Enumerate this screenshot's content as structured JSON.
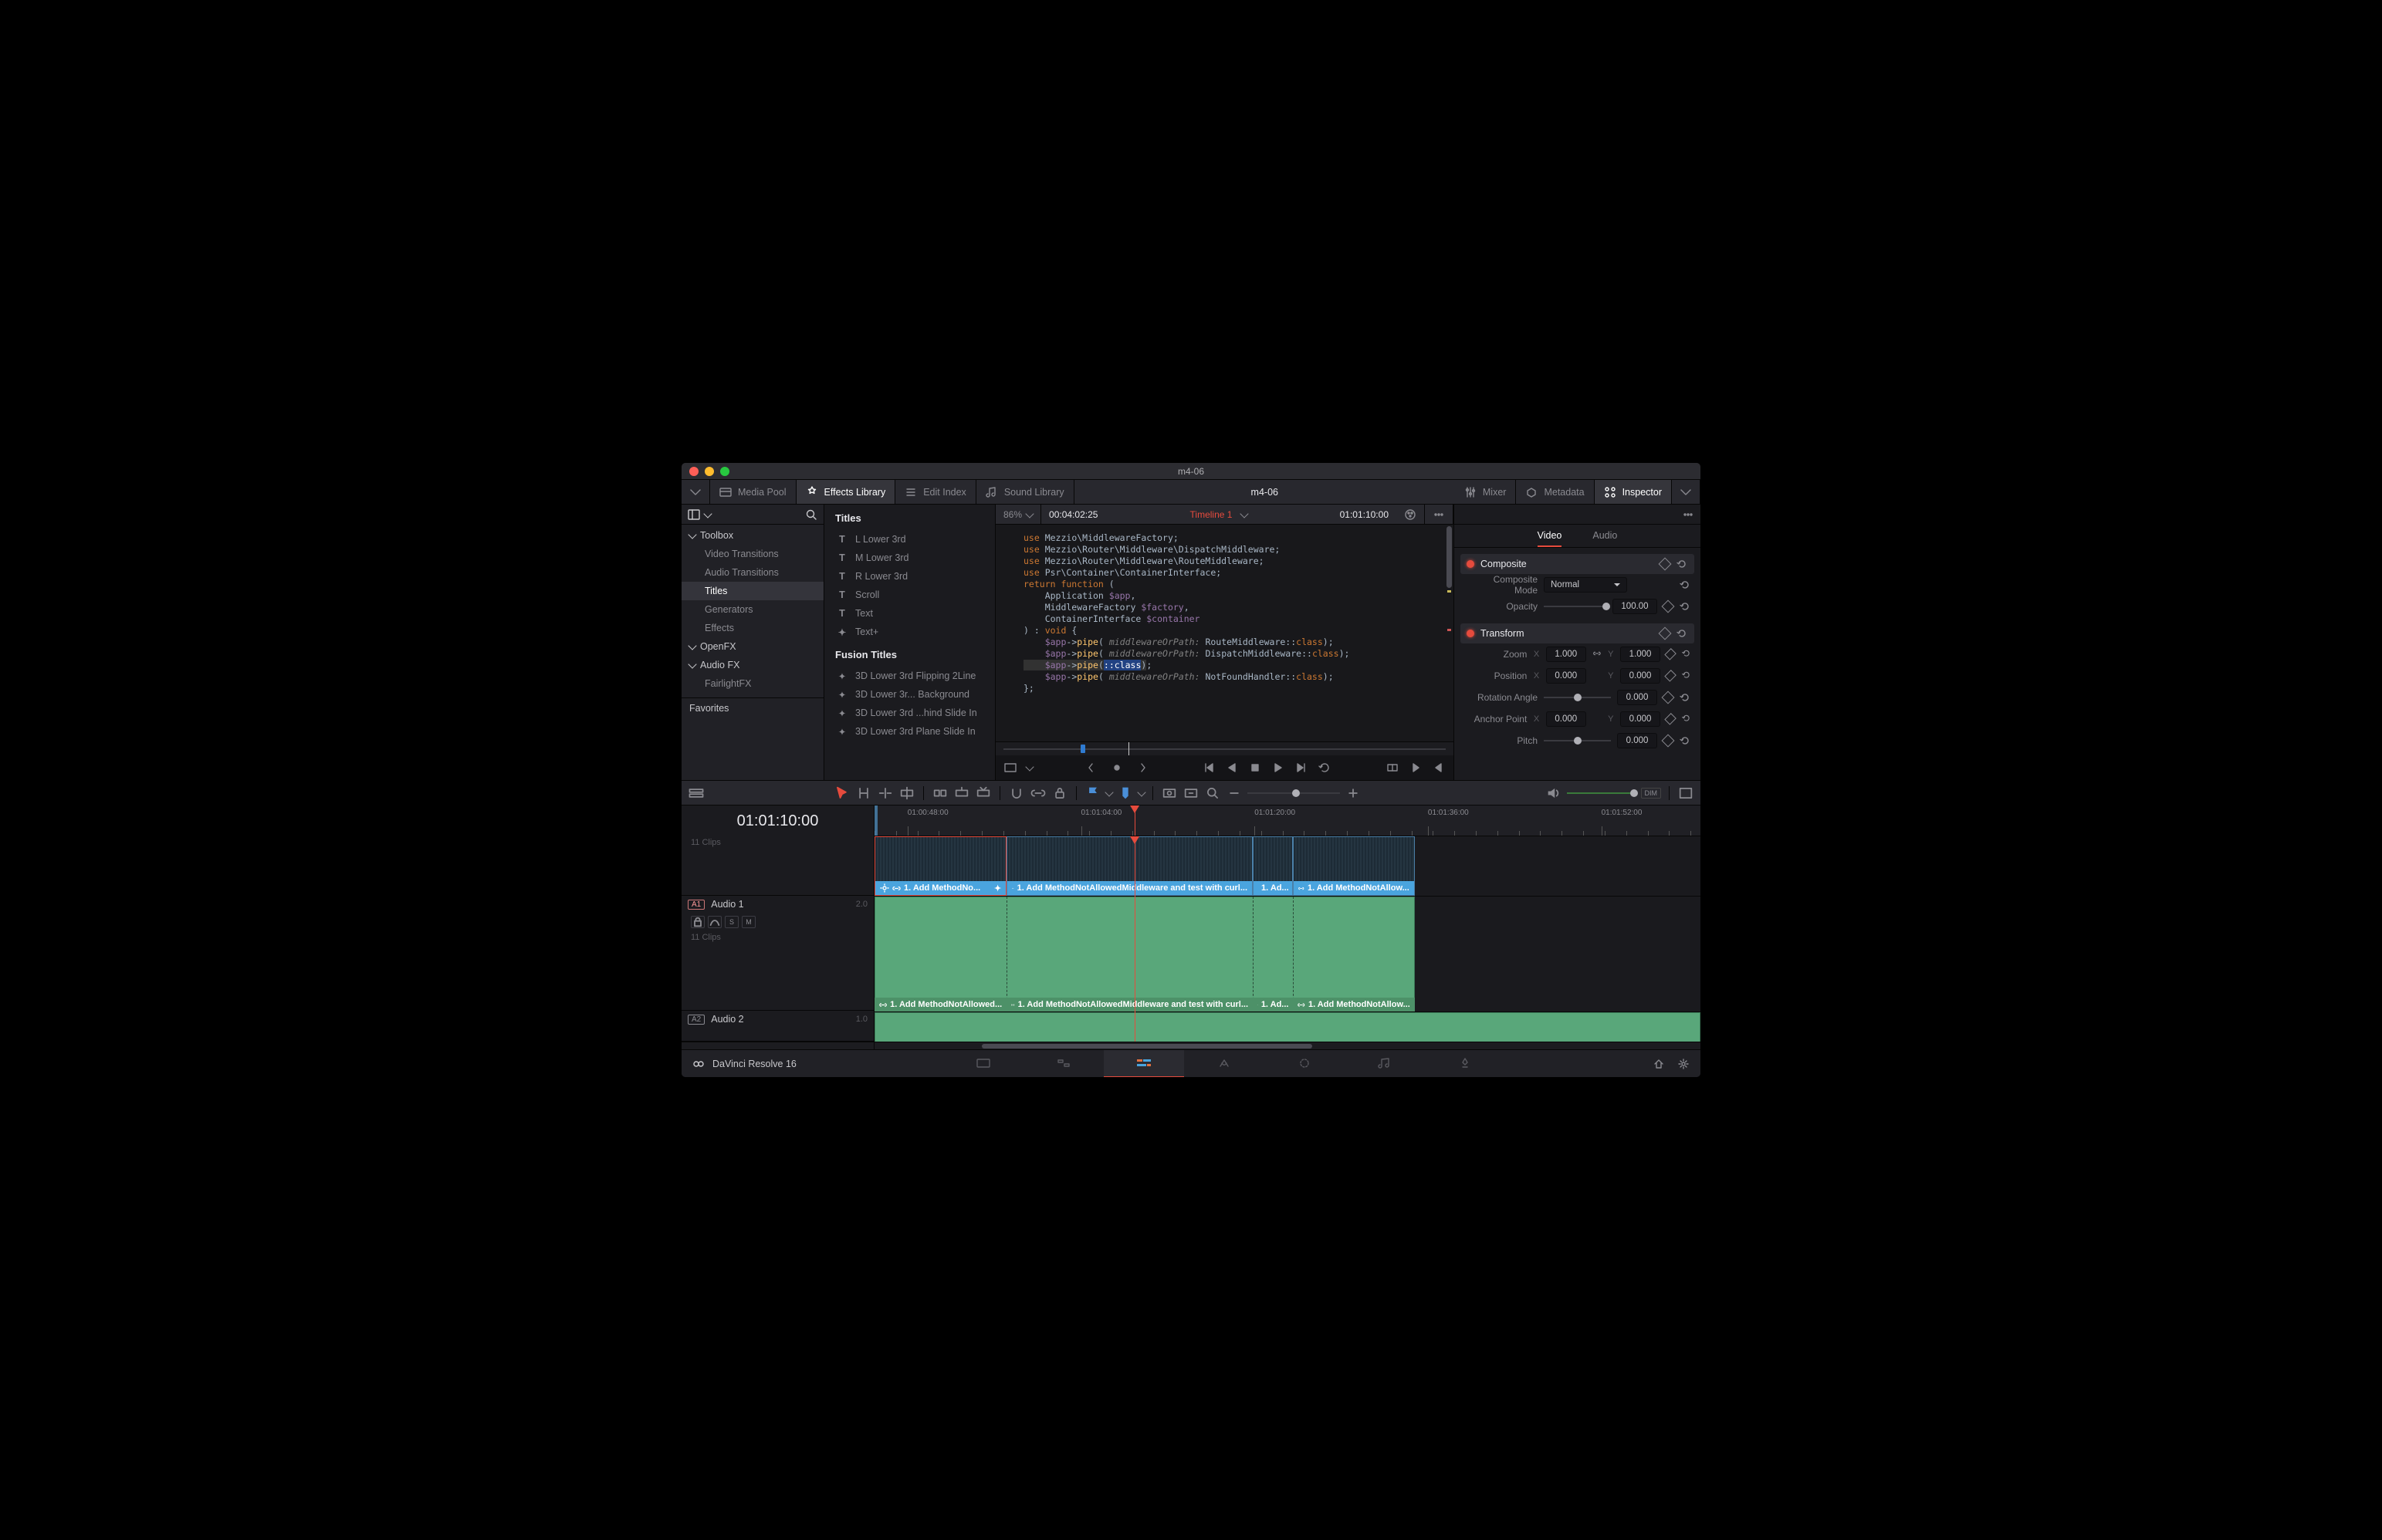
{
  "window": {
    "title": "m4-06"
  },
  "toolbar": {
    "media_pool": "Media Pool",
    "effects_library": "Effects Library",
    "edit_index": "Edit Index",
    "sound_library": "Sound Library",
    "doc_title": "m4-06",
    "mixer": "Mixer",
    "metadata": "Metadata",
    "inspector": "Inspector"
  },
  "sidebar": {
    "tree": [
      {
        "label": "Toolbox",
        "group": true
      },
      {
        "label": "Video Transitions"
      },
      {
        "label": "Audio Transitions"
      },
      {
        "label": "Titles",
        "active": true
      },
      {
        "label": "Generators"
      },
      {
        "label": "Effects"
      },
      {
        "label": "OpenFX",
        "group": true,
        "lvl": 0
      },
      {
        "label": "Audio FX",
        "group": true
      },
      {
        "label": "FairlightFX"
      }
    ],
    "favorites": "Favorites"
  },
  "effects": {
    "titles_header": "Titles",
    "titles_items": [
      "L Lower 3rd",
      "M Lower 3rd",
      "R Lower 3rd",
      "Scroll",
      "Text",
      "Text+"
    ],
    "fusion_header": "Fusion Titles",
    "fusion_items": [
      "3D Lower 3rd Flipping 2Line",
      "3D Lower 3r... Background",
      "3D Lower 3rd ...hind Slide In",
      "3D Lower 3rd Plane Slide In"
    ]
  },
  "viewer": {
    "zoom": "86%",
    "source_tc": "00:04:02:25",
    "timeline_name": "Timeline 1",
    "record_tc": "01:01:10:00",
    "code_lines": [
      [
        {
          "t": "use ",
          "c": "k"
        },
        {
          "t": "Mezzio\\MiddlewareFactory;",
          "c": ""
        }
      ],
      [
        {
          "t": "use ",
          "c": "k"
        },
        {
          "t": "Mezzio\\Router\\Middleware\\DispatchMiddleware;",
          "c": ""
        }
      ],
      [
        {
          "t": "use ",
          "c": "k"
        },
        {
          "t": "Mezzio\\Router\\Middleware\\RouteMiddleware;",
          "c": ""
        }
      ],
      [
        {
          "t": "use ",
          "c": "k"
        },
        {
          "t": "Psr\\Container\\ContainerInterface;",
          "c": ""
        }
      ],
      [
        {
          "t": "",
          "c": ""
        }
      ],
      [
        {
          "t": "return function ",
          "c": "k"
        },
        {
          "t": "(",
          "c": ""
        }
      ],
      [
        {
          "t": "    Application ",
          "c": ""
        },
        {
          "t": "$app",
          "c": "v"
        },
        {
          "t": ",",
          "c": ""
        }
      ],
      [
        {
          "t": "    MiddlewareFactory ",
          "c": ""
        },
        {
          "t": "$factory",
          "c": "v"
        },
        {
          "t": ",",
          "c": ""
        }
      ],
      [
        {
          "t": "    ContainerInterface ",
          "c": ""
        },
        {
          "t": "$container",
          "c": "v"
        }
      ],
      [
        {
          "t": ") : ",
          "c": ""
        },
        {
          "t": "void ",
          "c": "k"
        },
        {
          "t": "{",
          "c": ""
        }
      ],
      [
        {
          "t": "    $app",
          "c": "v"
        },
        {
          "t": "->",
          "c": ""
        },
        {
          "t": "pipe",
          "c": "fn"
        },
        {
          "t": "(",
          "c": ""
        },
        {
          "t": " middlewareOrPath: ",
          "c": "c"
        },
        {
          "t": "RouteMiddleware::",
          "c": ""
        },
        {
          "t": "class",
          "c": "k"
        },
        {
          "t": ");",
          "c": ""
        }
      ],
      [
        {
          "t": "    $app",
          "c": "v"
        },
        {
          "t": "->",
          "c": ""
        },
        {
          "t": "pipe",
          "c": "fn"
        },
        {
          "t": "(",
          "c": ""
        },
        {
          "t": " middlewareOrPath: ",
          "c": "c"
        },
        {
          "t": "DispatchMiddleware::",
          "c": ""
        },
        {
          "t": "class",
          "c": "k"
        },
        {
          "t": ");",
          "c": ""
        }
      ],
      [
        {
          "t": "    ",
          "c": "hl"
        },
        {
          "t": "$app",
          "c": "v hl"
        },
        {
          "t": "->",
          "c": "hl"
        },
        {
          "t": "pipe",
          "c": "fn hl"
        },
        {
          "t": "(",
          "c": "hl"
        },
        {
          "t": "::class",
          "c": "sel"
        },
        {
          "t": ")",
          "c": "hl"
        },
        {
          "t": ";",
          "c": ""
        }
      ],
      [
        {
          "t": "    $app",
          "c": "v"
        },
        {
          "t": "->",
          "c": ""
        },
        {
          "t": "pipe",
          "c": "fn"
        },
        {
          "t": "(",
          "c": ""
        },
        {
          "t": " middlewareOrPath: ",
          "c": "c"
        },
        {
          "t": "NotFoundHandler::",
          "c": ""
        },
        {
          "t": "class",
          "c": "k"
        },
        {
          "t": ");",
          "c": ""
        }
      ],
      [
        {
          "t": "};",
          "c": ""
        }
      ]
    ]
  },
  "inspector": {
    "tabs": {
      "video": "Video",
      "audio": "Audio"
    },
    "composite": {
      "title": "Composite",
      "mode_label": "Composite Mode",
      "mode_value": "Normal",
      "opacity_label": "Opacity",
      "opacity_value": "100.00"
    },
    "transform": {
      "title": "Transform",
      "zoom_label": "Zoom",
      "zoom_x": "1.000",
      "zoom_y": "1.000",
      "position_label": "Position",
      "pos_x": "0.000",
      "pos_y": "0.000",
      "rotation_label": "Rotation Angle",
      "rotation": "0.000",
      "anchor_label": "Anchor Point",
      "anchor_x": "0.000",
      "anchor_y": "0.000",
      "pitch_label": "Pitch",
      "pitch": "0.000"
    }
  },
  "timeline": {
    "timecode": "01:01:10:00",
    "ruler_labels": [
      "01:00:48:00",
      "01:01:04:00",
      "01:01:20:00",
      "01:01:36:00",
      "01:01:52:00"
    ],
    "video": {
      "count": "11 Clips",
      "clips": [
        {
          "left": 0,
          "width": 16.0,
          "label": "1. Add MethodNo...",
          "sel": true,
          "gear": true
        },
        {
          "left": 16.0,
          "width": 29.8,
          "label": "1. Add MethodNotAllowedMiddleware and test with curl..."
        },
        {
          "left": 45.8,
          "width": 4.9,
          "label": "1. Ad..."
        },
        {
          "left": 50.7,
          "width": 14.7,
          "label": "1. Add MethodNotAllow..."
        }
      ]
    },
    "audio1": {
      "tag": "A1",
      "name": "Audio 1",
      "level": "2.0",
      "count": "11 Clips",
      "clips": [
        {
          "left": 0,
          "width": 16.0,
          "label": "1. Add MethodNotAllowed..."
        },
        {
          "left": 16.0,
          "width": 29.8,
          "label": "1. Add MethodNotAllowedMiddleware and test with curl..."
        },
        {
          "left": 45.8,
          "width": 4.9,
          "label": "1. Ad..."
        },
        {
          "left": 50.7,
          "width": 14.7,
          "label": "1. Add MethodNotAllow..."
        }
      ],
      "cuts": [
        16.0,
        45.8,
        50.7
      ]
    },
    "audio2": {
      "tag": "A2",
      "name": "Audio 2",
      "level": "1.0"
    }
  },
  "bottom": {
    "app": "DaVinci Resolve 16"
  },
  "axis": {
    "x": "X",
    "y": "Y"
  },
  "trk_btns": {
    "s": "S",
    "m": "M"
  },
  "dim_label": "DIM"
}
